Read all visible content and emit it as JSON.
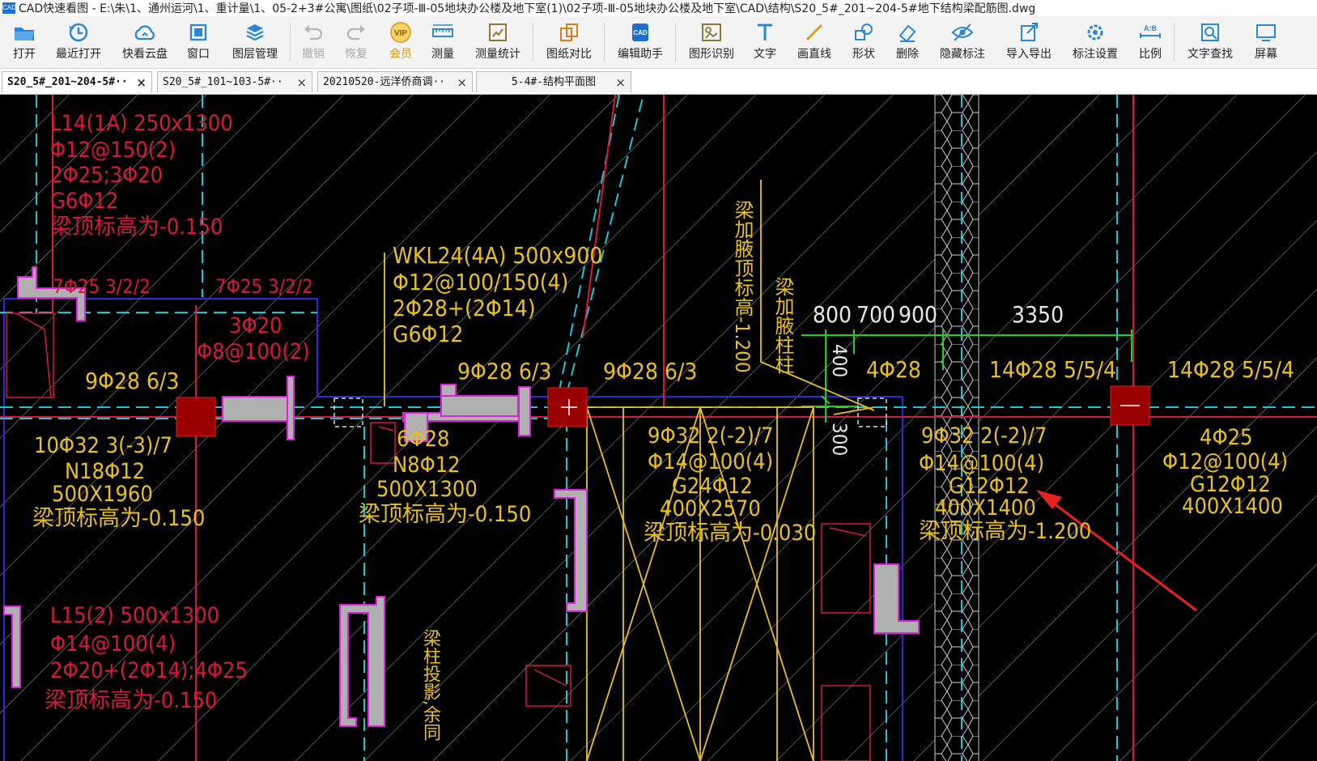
{
  "window": {
    "title": "CAD快速看图 - E:\\朱\\1、通州运河\\1、重计量\\1、05-2+3#公寓\\图纸\\02子项-Ⅲ-05地块办公楼及地下室(1)\\02子项-Ⅲ-05地块办公楼及地下室\\CAD\\结构\\S20_5#_201~204-5#地下结构梁配筋图.dwg",
    "app_icon_text": "CAD"
  },
  "toolbar": {
    "open": "打开",
    "recent": "最近打开",
    "cloud": "快看云盘",
    "window": "窗口",
    "layers": "图层管理",
    "undo": "撤销",
    "redo": "恢复",
    "vip": "会员",
    "vip_badge": "VIP",
    "measure": "测量",
    "measure_stats": "测量统计",
    "compare": "图纸对比",
    "edit_helper": "编辑助手",
    "edit_helper_badge": "CAD",
    "shape_recognize": "图形识别",
    "text": "文字",
    "draw_line": "画直线",
    "shape": "形状",
    "delete": "删除",
    "hide_marks": "隐藏标注",
    "import_export": "导入导出",
    "mark_settings": "标注设置",
    "scale": "比例",
    "scale_badge": "A:B",
    "find_text": "文字查找",
    "screen": "屏幕"
  },
  "tabs": [
    {
      "label": "S20_5#_201~204-5#··",
      "active": true
    },
    {
      "label": "S20_5#_101~103-5#··",
      "active": false
    },
    {
      "label": "20210520-远洋侨商调··",
      "active": false
    },
    {
      "label": "5-4#-结构平面图",
      "active": false
    }
  ],
  "tab_close": "×",
  "drawing": {
    "colors": {
      "yellow": "#e8c21a",
      "red": "#d8193a",
      "magenta": "#e020e0",
      "cyan": "#18c8d8",
      "blue": "#2a2ad8",
      "green": "#22d022",
      "column": "#9a0000",
      "white": "#e8e8e8",
      "gray": "#b0b0b0"
    },
    "annotations": {
      "l14_1": "L14(1A) 250x1300",
      "l14_2": "Φ12@150(2)",
      "l14_3": "2Φ25;3Φ20",
      "l14_4": "G6Φ12",
      "l14_5": "梁顶标高为-0.150",
      "r_7a": "7Φ25 3/2/2",
      "r_7b": "7Φ25 3/2/2",
      "r_3": "3Φ20",
      "r_8": "Φ8@100(2)",
      "wkl_1": "WKL24(4A) 500x900",
      "wkl_2": "Φ12@100/150(4)",
      "wkl_3": "2Φ28+(2Φ14)",
      "wkl_4": "G6Φ12",
      "v_haunch1": "梁加腋顶标高-1.200",
      "v_haunch2": "梁加腋柱柱",
      "d800": "800",
      "d700": "700",
      "d900": "900",
      "d3350": "3350",
      "d400": "400",
      "d300": "300",
      "t9_28a": "9Φ28 6/3",
      "t9_28b": "9Φ28 6/3",
      "t9_28c": "9Φ28 6/3",
      "t4_28": "4Φ28",
      "t14a": "14Φ28 5/5/4",
      "t14b": "14Φ28 5/5/4",
      "b1_1": "10Φ32 3(-3)/7",
      "b1_2": "N18Φ12",
      "b1_3": "500X1960",
      "b1_4": "梁顶标高为-0.150",
      "b2_1": "6Φ28",
      "b2_2": "N8Φ12",
      "b2_3": "500X1300",
      "b2_4": "梁顶标高为-0.150",
      "b3_1": "9Φ32 2(-2)/7",
      "b3_2": "Φ14@100(4)",
      "b3_3": "G24Φ12",
      "b3_4": "400X2570",
      "b3_5": "梁顶标高为-0.030",
      "b4_1": "9Φ32 2(-2)/7",
      "b4_2": "Φ14@100(4)",
      "b4_3": "G12Φ12",
      "b4_4": "400X1400",
      "b4_5": "梁顶标高为-1.200",
      "b5_1": "4Φ25",
      "b5_2": "Φ12@100(4)",
      "b5_3": "G12Φ12",
      "b5_4": "400X1400",
      "l15_1": "L15(2) 500x1300",
      "l15_2": "Φ14@100(4)",
      "l15_3": "2Φ20+(2Φ14);4Φ25",
      "l15_4": "梁顶标高为-0.150",
      "v_bottom": "梁柱投影,余同"
    }
  }
}
